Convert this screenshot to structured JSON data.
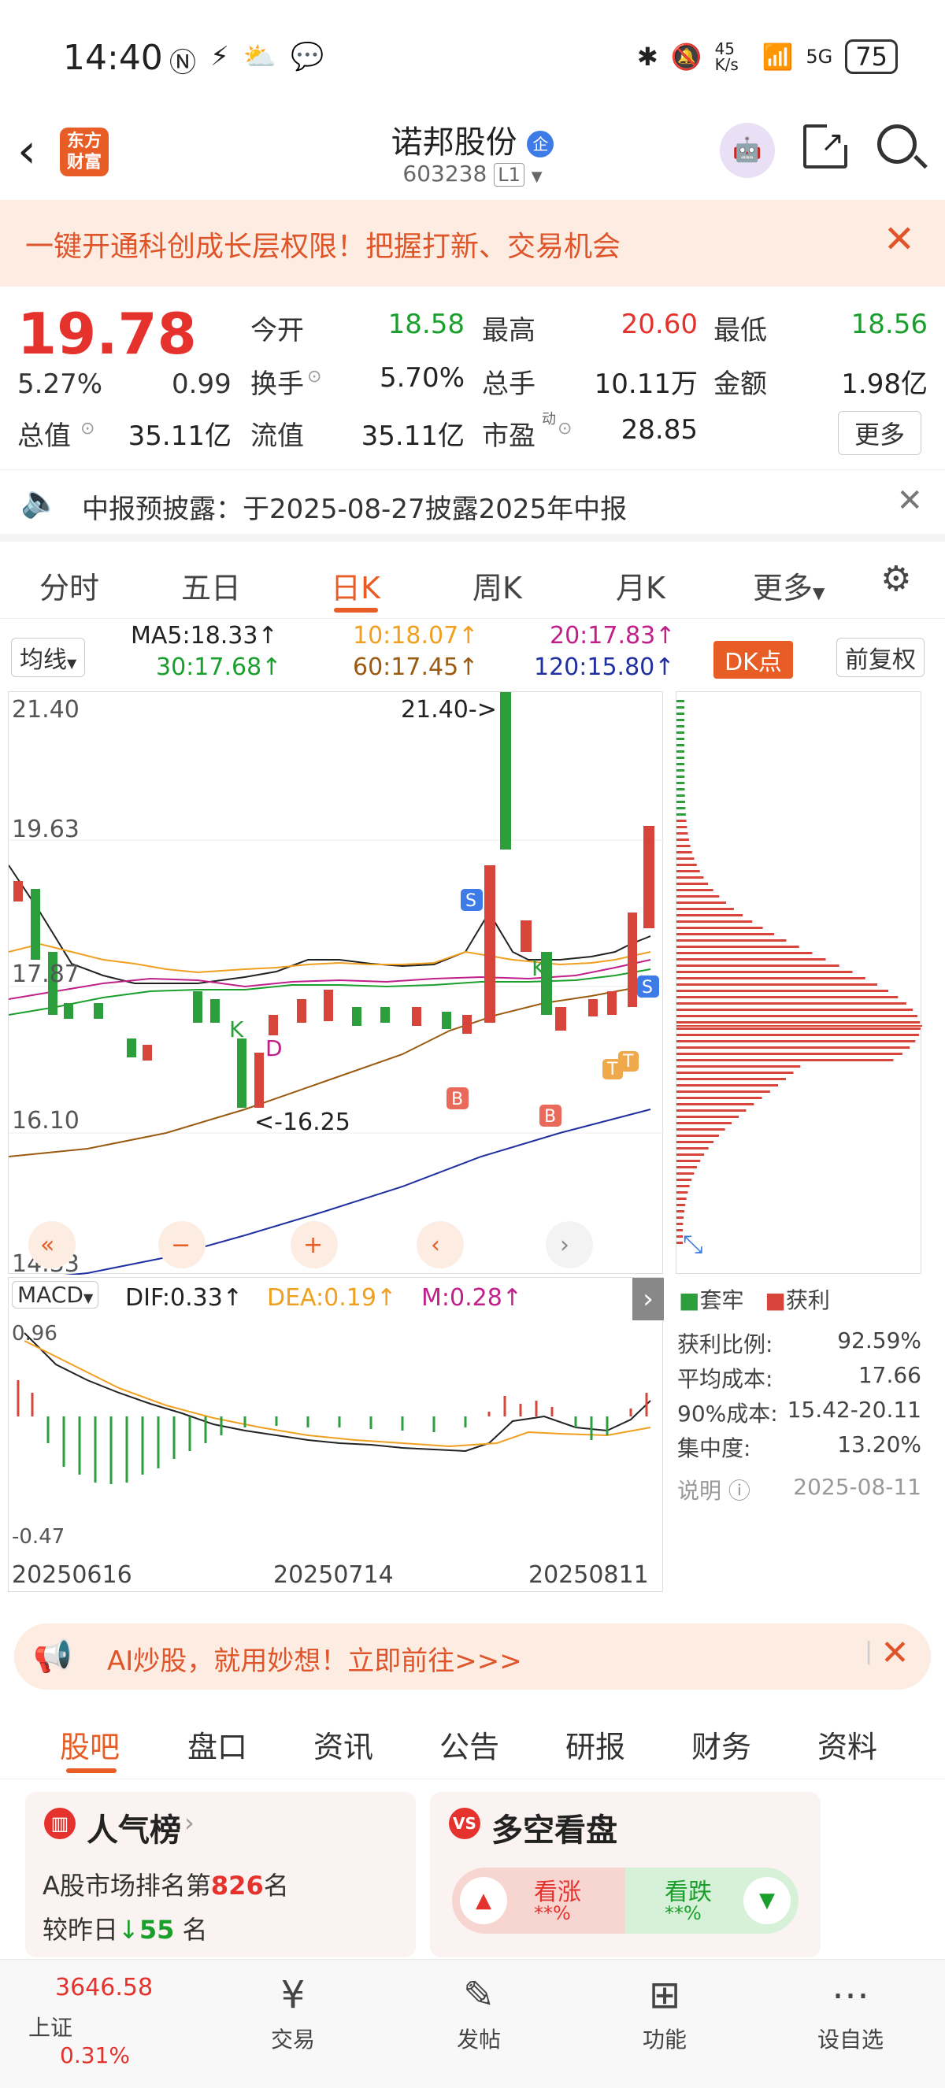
{
  "status_bar": {
    "time": "14:40",
    "speed": "45 K/s",
    "network": "5G",
    "battery": "75"
  },
  "header": {
    "app_logo": "东方财富",
    "stock_name": "诺邦股份",
    "enterprise_badge": "企",
    "stock_code": "603238",
    "level": "L1"
  },
  "promo": {
    "text": "一键开通科创成长层权限！把握打新、交易机会"
  },
  "quote": {
    "price": "19.78",
    "change_pct": "5.27%",
    "change": "0.99",
    "open_label": "今开",
    "open": "18.58",
    "high_label": "最高",
    "high": "20.60",
    "low_label": "最低",
    "low": "18.56",
    "turnover_label": "换手",
    "turnover": "5.70%",
    "volume_label": "总手",
    "volume": "10.11万",
    "amount_label": "金额",
    "amount": "1.98亿",
    "mktcap_label": "总值",
    "mktcap": "35.11亿",
    "float_label": "流值",
    "float": "35.11亿",
    "pe_label": "市盈",
    "pe_sup": "动",
    "pe": "28.85",
    "more": "更多"
  },
  "notice": {
    "text": "中报预披露：于2025-08-27披露2025年中报"
  },
  "tabs": [
    "分时",
    "五日",
    "日K",
    "周K",
    "月K",
    "更多"
  ],
  "ma_row": {
    "selector": "均线",
    "ma5": "MA5:18.33↑",
    "ma10": "10:18.07↑",
    "ma20": "20:17.83↑",
    "ma30": "30:17.68↑",
    "ma60": "60:17.45↑",
    "ma120": "120:15.80↑",
    "dk": "DK点",
    "adjust": "前复权"
  },
  "kline": {
    "y_labels": [
      "21.40",
      "19.63",
      "17.87",
      "16.10",
      "14.33"
    ],
    "high_annotation": "21.40->",
    "low_annotation": "<-16.25",
    "x_labels": [
      "20250616",
      "20250714",
      "20250811"
    ],
    "markers": {
      "s": "S",
      "b": "B",
      "k": "K",
      "t": "T",
      "d": "D"
    }
  },
  "macd": {
    "selector": "MACD",
    "dif": "DIF:0.33↑",
    "dea": "DEA:0.19↑",
    "m": "M:0.28↑",
    "top": "0.96",
    "bottom": "-0.47"
  },
  "profile": {
    "legend_lock": "套牢",
    "legend_profit": "获利",
    "stats": [
      {
        "label": "获利比例:",
        "value": "92.59%"
      },
      {
        "label": "平均成本:",
        "value": "17.66"
      },
      {
        "label": "90%成本:",
        "value": "15.42-20.11"
      },
      {
        "label": "集中度:",
        "value": "13.20%"
      }
    ],
    "note_label": "说明",
    "date": "2025-08-11"
  },
  "ai_banner": {
    "text": "AI炒股，就用妙想！立即前往>>>"
  },
  "sub_tabs": [
    "股吧",
    "盘口",
    "资讯",
    "公告",
    "研报",
    "财务",
    "资料"
  ],
  "popularity": {
    "title": "人气榜",
    "rank_prefix": "A股市场排名第",
    "rank": "826",
    "rank_suffix": "名",
    "change_prefix": "较昨日",
    "change": "55",
    "change_suffix": "名"
  },
  "sentiment": {
    "title": "多空看盘",
    "up_label": "看涨",
    "up_value": "**%",
    "down_label": "看跌",
    "down_value": "**%"
  },
  "bottom_nav": {
    "index_value": "3646.58",
    "index_name": "上证",
    "index_pct": "0.31%",
    "trade": "交易",
    "post": "发帖",
    "features": "功能",
    "watchlist": "设自选"
  }
}
